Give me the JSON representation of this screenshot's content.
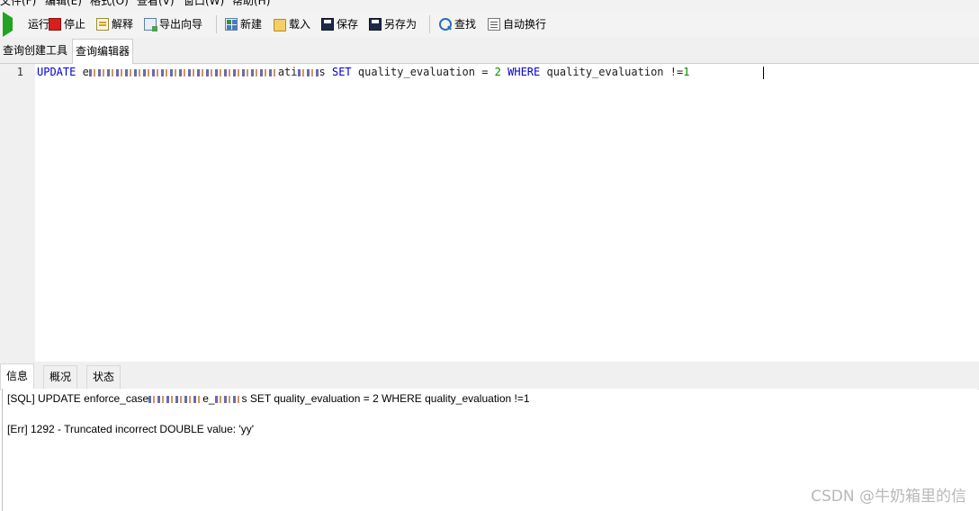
{
  "menu": {
    "items": [
      "文件(F)",
      "编辑(E)",
      "格式(O)",
      "查看(V)",
      "窗口(W)",
      "帮助(H)"
    ]
  },
  "toolbar": {
    "run": "运行",
    "stop": "停止",
    "explain": "解释",
    "export_wizard": "导出向导",
    "new": "新建",
    "load": "载入",
    "save": "保存",
    "save_as": "另存为",
    "find": "查找",
    "word_wrap": "自动换行"
  },
  "editor_tabs": {
    "query_builder": "查询创建工具",
    "query_editor": "查询编辑器"
  },
  "editor": {
    "line_number": "1",
    "kw_update": "UPDATE",
    "table_prefix": "e",
    "table_suffix_fragment": "ati",
    "table_end": "s",
    "kw_set": "SET",
    "col1": "quality_evaluation",
    "op_eq": "=",
    "val": "2",
    "kw_where": "WHERE",
    "col2": "quality_evaluation",
    "op_ne": "!=",
    "val2": "1"
  },
  "panel_tabs": {
    "info": "信息",
    "overview": "概况",
    "status": "状态"
  },
  "messages": {
    "sql_prefix": "[SQL] UPDATE enforce_case",
    "sql_mid": "e_",
    "sql_suffix": "s SET quality_evaluation = 2 WHERE quality_evaluation !=1",
    "error": "[Err] 1292 - Truncated incorrect DOUBLE value: 'yy'"
  },
  "watermark": "CSDN @牛奶箱里的信"
}
